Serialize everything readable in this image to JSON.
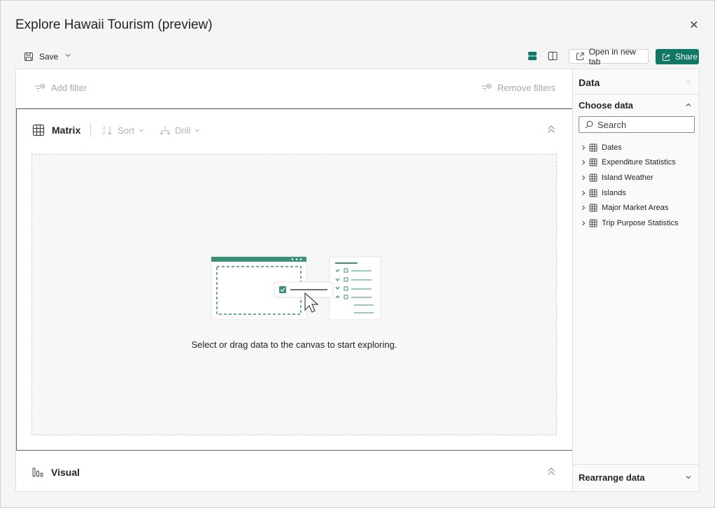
{
  "dialog": {
    "title": "Explore Hawaii Tourism (preview)",
    "close_glyph": "✕"
  },
  "toolbar": {
    "save_label": "Save",
    "open_new_tab_label": "Open in new tab",
    "share_label": "Share"
  },
  "filters": {
    "add_label": "Add filter",
    "remove_label": "Remove filters"
  },
  "matrix": {
    "title": "Matrix",
    "sort_label": "Sort",
    "drill_label": "Drill",
    "empty_message": "Select or drag data to the canvas to start exploring."
  },
  "visual": {
    "title": "Visual"
  },
  "data_pane": {
    "title": "Data",
    "choose_label": "Choose data",
    "search_placeholder": "Search",
    "tables": [
      "Dates",
      "Expenditure Statistics",
      "Island Weather",
      "Islands",
      "Major Market Areas",
      "Trip Purpose Statistics"
    ],
    "rearrange_label": "Rearrange data"
  },
  "colors": {
    "accent": "#117865",
    "illustration": "#3a8f79"
  }
}
